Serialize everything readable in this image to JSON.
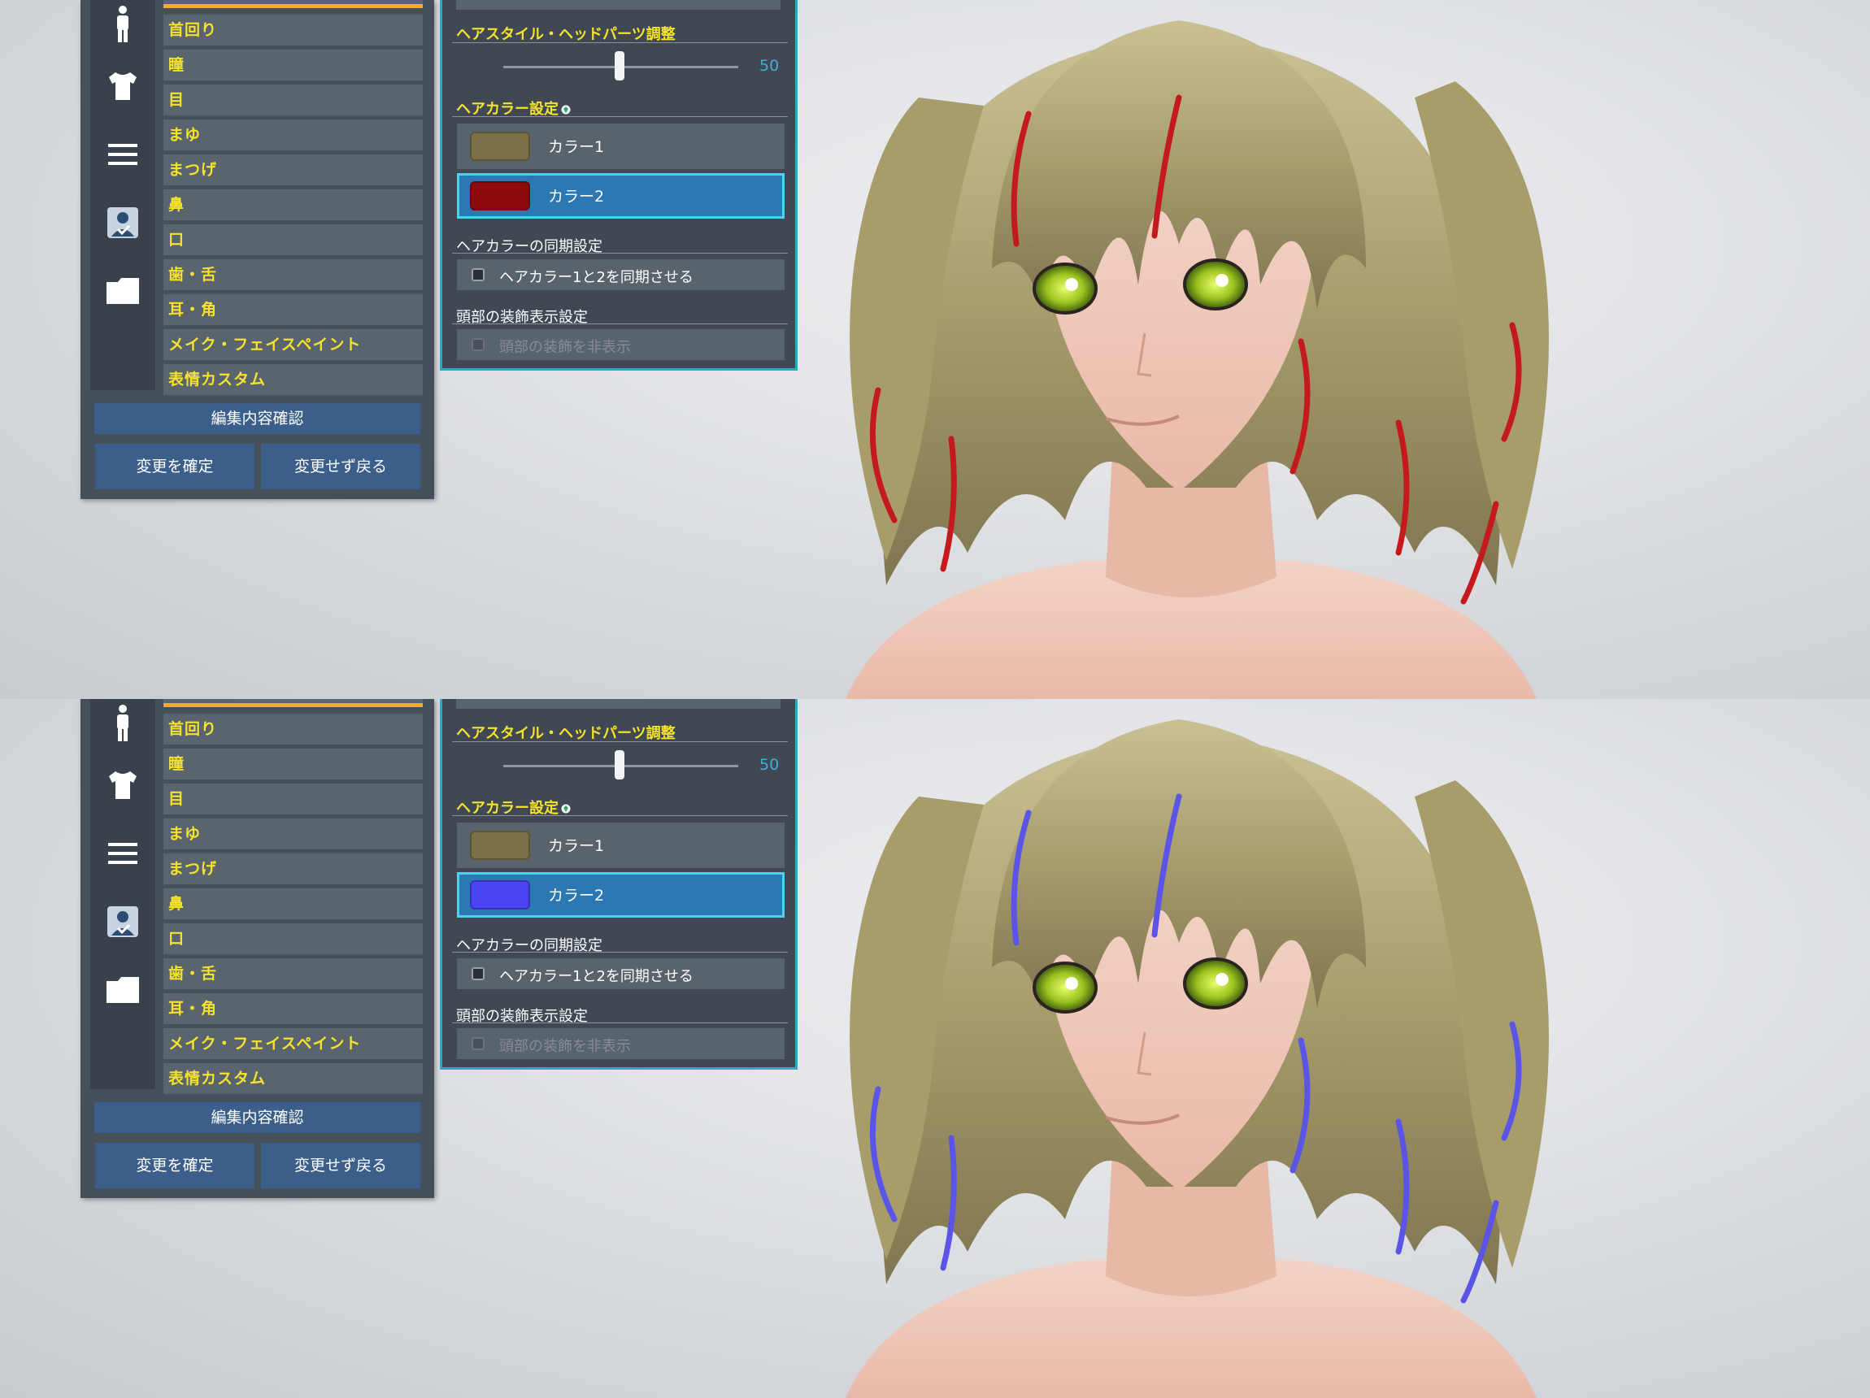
{
  "panels": [
    {
      "menu": {
        "items": [
          "首回り",
          "瞳",
          "目",
          "まゆ",
          "まつげ",
          "鼻",
          "口",
          "歯・舌",
          "耳・角",
          "メイク・フェイスペイント",
          "表情カスタム"
        ],
        "confirm_edit": "編集内容確認",
        "apply": "変更を確定",
        "revert": "変更せず戻る"
      },
      "settings": {
        "hairstyle_title": "ヘアスタイル・ヘッドパーツ調整",
        "slider_value": "50",
        "haircolor_title": "ヘアカラー設定",
        "color1_label": "カラー1",
        "color1_swatch": "#7d6f47",
        "color2_label": "カラー2",
        "color2_swatch": "#8f0a0f",
        "sync_title": "ヘアカラーの同期設定",
        "sync_label": "ヘアカラー1と2を同期させる",
        "decor_title": "頭部の装飾表示設定",
        "decor_label": "頭部の装飾を非表示"
      },
      "streak_color": "#c4191d"
    },
    {
      "menu": {
        "items": [
          "首回り",
          "瞳",
          "目",
          "まゆ",
          "まつげ",
          "鼻",
          "口",
          "歯・舌",
          "耳・角",
          "メイク・フェイスペイント",
          "表情カスタム"
        ],
        "confirm_edit": "編集内容確認",
        "apply": "変更を確定",
        "revert": "変更せず戻る"
      },
      "settings": {
        "hairstyle_title": "ヘアスタイル・ヘッドパーツ調整",
        "slider_value": "50",
        "haircolor_title": "ヘアカラー設定",
        "color1_label": "カラー1",
        "color1_swatch": "#7d6f47",
        "color2_label": "カラー2",
        "color2_swatch": "#4a43f2",
        "sync_title": "ヘアカラーの同期設定",
        "sync_label": "ヘアカラー1と2を同期させる",
        "decor_title": "頭部の装飾表示設定",
        "decor_label": "頭部の装飾を非表示"
      },
      "streak_color": "#5a55e6"
    }
  ],
  "icons": [
    "body-icon",
    "shirt-icon",
    "menu-lines-icon",
    "face-profile-icon",
    "folder-icon"
  ],
  "colors": {
    "accent_yellow": "#f4e22c",
    "selection_blue": "#2b78b2",
    "panel_border": "#2ea6c4"
  }
}
